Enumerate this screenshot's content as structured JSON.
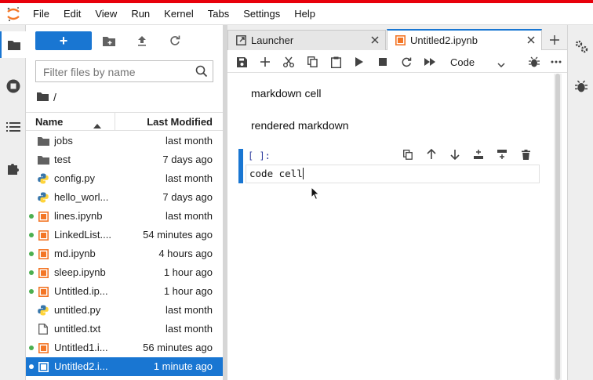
{
  "colors": {
    "accent": "#1976d2",
    "top_stripe": "#e8000b",
    "notebook_icon": "#f37626",
    "running_dot": "#4caf50",
    "python_blue": "#3776ab",
    "python_yellow": "#ffd43b"
  },
  "menu": {
    "logo_icon": "jupyter-logo-icon",
    "items": [
      "File",
      "Edit",
      "View",
      "Run",
      "Kernel",
      "Tabs",
      "Settings",
      "Help"
    ]
  },
  "left_rail": {
    "icons": [
      "folder-icon",
      "running-icon",
      "toc-icon",
      "extension-icon"
    ]
  },
  "file_browser": {
    "new_label": "+",
    "toolbar_icons": [
      "new-folder-icon",
      "upload-icon",
      "refresh-icon"
    ],
    "filter_placeholder": "Filter files by name",
    "breadcrumb": "/",
    "headers": {
      "name": "Name",
      "modified": "Last Modified"
    },
    "files": [
      {
        "name": "jobs",
        "modified": "last month",
        "type": "folder",
        "running": false,
        "selected": false
      },
      {
        "name": "test",
        "modified": "7 days ago",
        "type": "folder",
        "running": false,
        "selected": false
      },
      {
        "name": "config.py",
        "modified": "last month",
        "type": "python",
        "running": false,
        "selected": false
      },
      {
        "name": "hello_worl...",
        "modified": "7 days ago",
        "type": "python",
        "running": false,
        "selected": false
      },
      {
        "name": "lines.ipynb",
        "modified": "last month",
        "type": "notebook",
        "running": true,
        "selected": false
      },
      {
        "name": "LinkedList....",
        "modified": "54 minutes ago",
        "type": "notebook",
        "running": true,
        "selected": false
      },
      {
        "name": "md.ipynb",
        "modified": "4 hours ago",
        "type": "notebook",
        "running": true,
        "selected": false
      },
      {
        "name": "sleep.ipynb",
        "modified": "1 hour ago",
        "type": "notebook",
        "running": true,
        "selected": false
      },
      {
        "name": "Untitled.ip...",
        "modified": "1 hour ago",
        "type": "notebook",
        "running": true,
        "selected": false
      },
      {
        "name": "untitled.py",
        "modified": "last month",
        "type": "python",
        "running": false,
        "selected": false
      },
      {
        "name": "untitled.txt",
        "modified": "last month",
        "type": "text",
        "running": false,
        "selected": false
      },
      {
        "name": "Untitled1.i...",
        "modified": "56 minutes ago",
        "type": "notebook",
        "running": true,
        "selected": false
      },
      {
        "name": "Untitled2.i...",
        "modified": "1 minute ago",
        "type": "notebook",
        "running": true,
        "selected": true
      }
    ]
  },
  "tabs": [
    {
      "label": "Launcher",
      "icon": "launcher-icon",
      "active": false
    },
    {
      "label": "Untitled2.ipynb",
      "icon": "notebook-icon",
      "active": true
    }
  ],
  "notebook_toolbar": {
    "icons": [
      "save-icon",
      "add-cell-icon",
      "cut-icon",
      "copy-icon",
      "paste-icon",
      "run-icon",
      "stop-icon",
      "restart-icon",
      "fast-forward-icon"
    ],
    "cell_type": "Code",
    "right_icons": [
      "debugger-icon",
      "more-icon"
    ]
  },
  "notebook": {
    "markdown_cells": [
      "markdown cell",
      "rendered markdown"
    ],
    "code_cell": {
      "prompt": "[ ]:",
      "source": "code cell",
      "toolbar_icons": [
        "duplicate-cell-icon",
        "move-up-icon",
        "move-down-icon",
        "insert-above-icon",
        "insert-below-icon",
        "delete-cell-icon"
      ]
    }
  },
  "right_rail": {
    "icons": [
      "property-inspector-icon",
      "debugger-panel-icon"
    ]
  }
}
